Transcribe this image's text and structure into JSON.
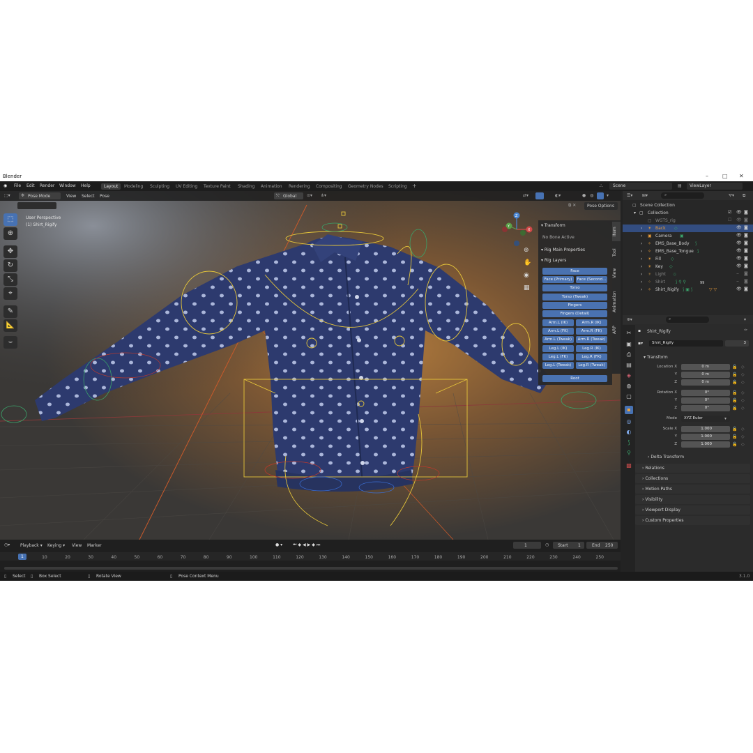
{
  "window": {
    "title": "Blender",
    "version": "3.1.0"
  },
  "menu": [
    "File",
    "Edit",
    "Render",
    "Window",
    "Help"
  ],
  "workspaces": [
    "Layout",
    "Modeling",
    "Sculpting",
    "UV Editing",
    "Texture Paint",
    "Shading",
    "Animation",
    "Rendering",
    "Compositing",
    "Geometry Nodes",
    "Scripting"
  ],
  "workspace_add": "+",
  "scene": {
    "name": "Scene",
    "view_layer": "ViewLayer"
  },
  "viewport": {
    "mode": "Pose Mode",
    "header_menus": [
      "View",
      "Select",
      "Pose"
    ],
    "orientation": "Global",
    "pose_options": "Pose Options",
    "overlay_title": "User Perspective",
    "overlay_object": "(1) Shirt_Rigify"
  },
  "npanel": {
    "transform_title": "Transform",
    "no_bone": "No Bone Active",
    "rig_main": "Rig Main Properties",
    "rig_layers": "Rig Layers",
    "buttons": [
      "Face",
      "Face (Primary)",
      "Face (Second...",
      "Torso",
      "Torso (Tweak)",
      "Fingers",
      "Fingers (Detail)",
      "Arm.L (IK)",
      "Arm.R (IK)",
      "Arm.L (FK)",
      "Arm.R (FK)",
      "Arm.L (Tweak)",
      "Arm.R (Tweak)",
      "Leg.L (IK)",
      "Leg.R (IK)",
      "Leg.L (FK)",
      "Leg.R (FK)",
      "Leg.L (Tweak)",
      "Leg.R (Tweak)",
      "Root"
    ],
    "tabs": [
      "Item",
      "Tool",
      "View",
      "Animation",
      "ARP"
    ]
  },
  "outliner": {
    "rows": [
      {
        "name": "Scene Collection"
      },
      {
        "name": "Collection"
      },
      {
        "name": "WGTS_rig"
      },
      {
        "name": "Back"
      },
      {
        "name": "Camera"
      },
      {
        "name": "EMS_Base_Body"
      },
      {
        "name": "EMS_Base_Tongue"
      },
      {
        "name": "Fill"
      },
      {
        "name": "Key"
      },
      {
        "name": "Light"
      },
      {
        "name": "Shirt"
      },
      {
        "name": "Shirt_Rigify"
      }
    ],
    "badge": "99"
  },
  "properties": {
    "object_name": "Shirt_Rigify",
    "data_name": "Shirt_Rigify",
    "users": "3",
    "transform": "Transform",
    "location_label": "Location X",
    "rotation_label": "Rotation X",
    "scale_label": "Scale X",
    "y": "Y",
    "z": "Z",
    "location": [
      "0 m",
      "0 m",
      "0 m"
    ],
    "rotation": [
      "0°",
      "0°",
      "0°"
    ],
    "mode_label": "Mode",
    "mode": "XYZ Euler",
    "scale": [
      "1.000",
      "1.000",
      "1.000"
    ],
    "sections": [
      "Delta Transform",
      "Relations",
      "Collections",
      "Motion Paths",
      "Visibility",
      "Viewport Display",
      "Custom Properties"
    ]
  },
  "timeline": {
    "menus": [
      "Playback",
      "Keying",
      "View",
      "Marker"
    ],
    "current": "1",
    "start_label": "Start",
    "start": "1",
    "end_label": "End",
    "end": "250",
    "ticks": [
      "1",
      "10",
      "20",
      "30",
      "40",
      "50",
      "60",
      "70",
      "80",
      "90",
      "100",
      "110",
      "120",
      "130",
      "140",
      "150",
      "160",
      "170",
      "180",
      "190",
      "200",
      "210",
      "220",
      "230",
      "240",
      "250"
    ]
  },
  "status": {
    "select": "Select",
    "box_select": "Box Select",
    "rotate": "Rotate View",
    "context": "Pose Context Menu"
  },
  "colors": {
    "accent": "#4772b3",
    "rig_button": "#4a72b0",
    "shirt": "#2d3a6e"
  }
}
